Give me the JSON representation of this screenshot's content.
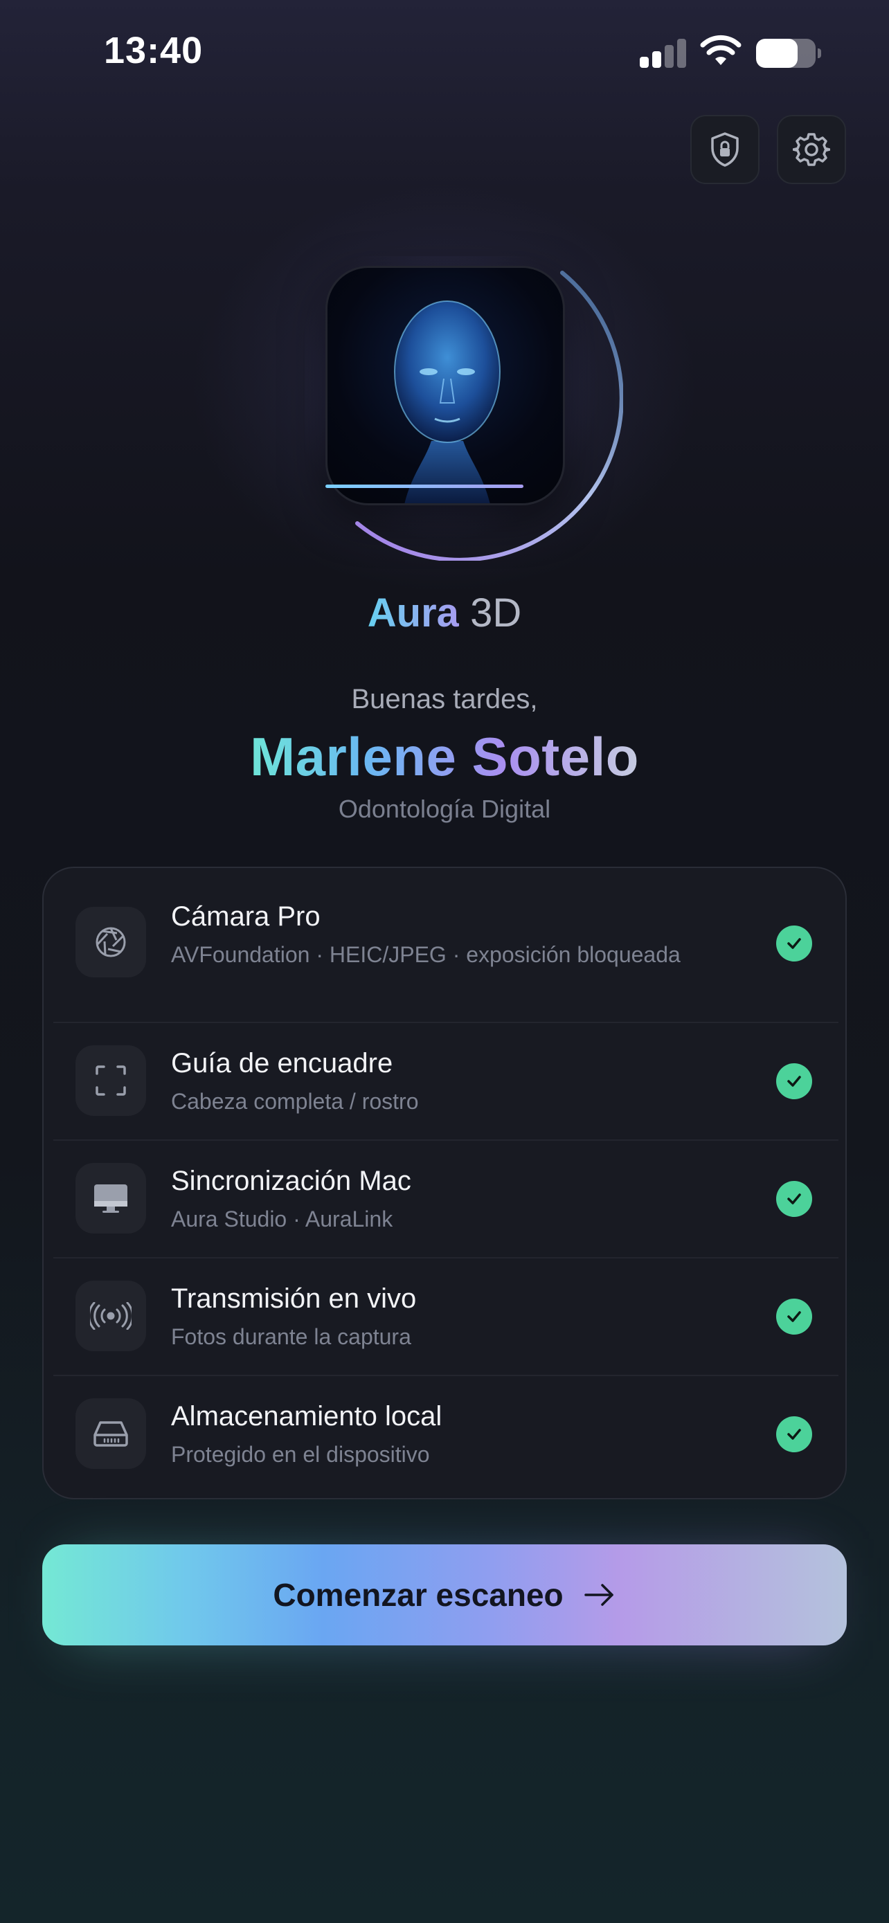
{
  "status_bar": {
    "time": "13:40",
    "battery_level": 0.7
  },
  "header": {
    "icons": [
      "shield-lock-icon",
      "gear-icon"
    ]
  },
  "brand": {
    "main": "Aura",
    "sub": "3D"
  },
  "greeting": "Buenas tardes,",
  "user": {
    "name": "Marlene Sotelo",
    "specialty": "Odontología Digital"
  },
  "features": [
    {
      "icon": "aperture-icon",
      "title": "Cámara Pro",
      "subtitle": "AVFoundation · HEIC/JPEG · exposición bloqueada",
      "status": "ok"
    },
    {
      "icon": "frame-corners-icon",
      "title": "Guía de encuadre",
      "subtitle": "Cabeza completa / rostro",
      "status": "ok"
    },
    {
      "icon": "desktop-icon",
      "title": "Sincronización Mac",
      "subtitle": "Aura Studio · AuraLink",
      "status": "ok"
    },
    {
      "icon": "broadcast-icon",
      "title": "Transmisión en vivo",
      "subtitle": "Fotos durante la captura",
      "status": "ok"
    },
    {
      "icon": "drive-icon",
      "title": "Almacenamiento local",
      "subtitle": "Protegido en el dispositivo",
      "status": "ok"
    }
  ],
  "cta": {
    "label": "Comenzar escaneo",
    "icon": "arrow-right-icon"
  },
  "colors": {
    "accent_start": "#74e8d4",
    "accent_mid": "#6aa6f2",
    "accent_end": "#b59be8",
    "check_green": "#4cd29a",
    "card_bg": "#181a22"
  }
}
